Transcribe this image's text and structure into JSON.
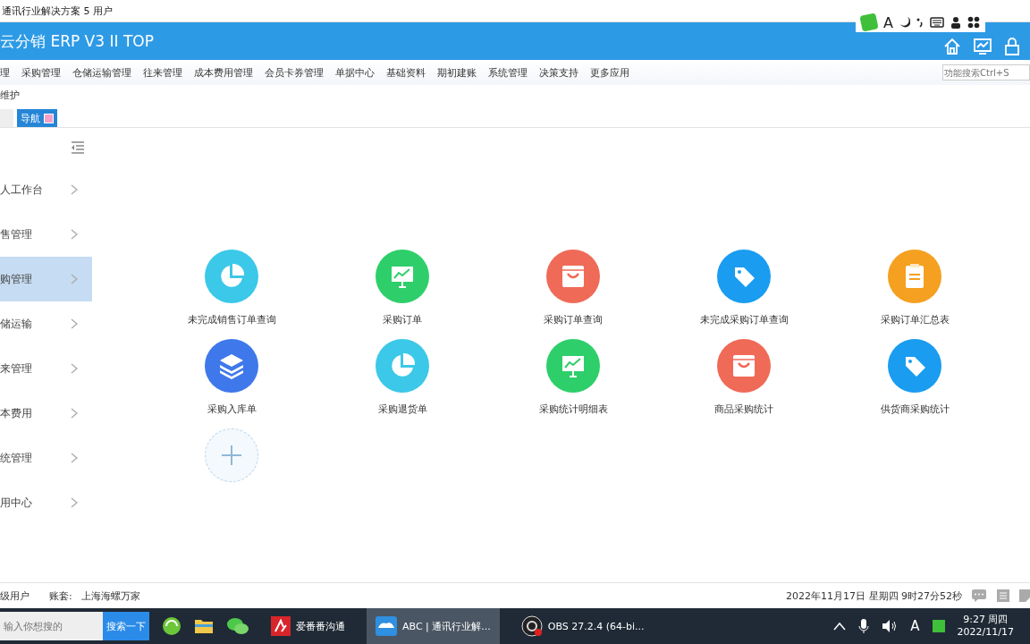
{
  "window": {
    "title": "通讯行业解决方案 5 用户"
  },
  "header": {
    "title": "云分销 ERP V3 II TOP"
  },
  "menu": [
    "理",
    "采购管理",
    "仓储运输管理",
    "往来管理",
    "成本费用管理",
    "会员卡券管理",
    "单据中心",
    "基础资料",
    "期初建账",
    "系统管理",
    "决策支持",
    "更多应用"
  ],
  "function_search": {
    "placeholder": "功能搜索Ctrl+S"
  },
  "breadcrumb": "维护",
  "tabs": [
    {
      "label": "导航",
      "selected": true
    }
  ],
  "sidebar": {
    "items": [
      {
        "label": "人工作台",
        "selected": false
      },
      {
        "label": "售管理",
        "selected": false
      },
      {
        "label": "购管理",
        "selected": true
      },
      {
        "label": "储运输",
        "selected": false
      },
      {
        "label": "来管理",
        "selected": false
      },
      {
        "label": "本费用",
        "selected": false
      },
      {
        "label": "统管理",
        "selected": false
      },
      {
        "label": "用中心",
        "selected": false
      }
    ]
  },
  "tiles": [
    {
      "label": "未完成销售订单查询",
      "kind": "pie",
      "color": "#3cc8e8"
    },
    {
      "label": "采购订单",
      "kind": "chart",
      "color": "#2ecf6a"
    },
    {
      "label": "采购订单查询",
      "kind": "bag",
      "color": "#f06a58"
    },
    {
      "label": "未完成采购订单查询",
      "kind": "tag",
      "color": "#1a9cf0"
    },
    {
      "label": "采购订单汇总表",
      "kind": "clipboard",
      "color": "#f5a020"
    },
    {
      "label": "采购入库单",
      "kind": "layers",
      "color": "#3f78ea"
    },
    {
      "label": "采购退货单",
      "kind": "pie",
      "color": "#3cc8e8"
    },
    {
      "label": "采购统计明细表",
      "kind": "chart",
      "color": "#2ecf6a"
    },
    {
      "label": "商品采购统计",
      "kind": "bag",
      "color": "#f06a58"
    },
    {
      "label": "供货商采购统计",
      "kind": "tag",
      "color": "#1a9cf0"
    }
  ],
  "status_bar": {
    "user": "级用户",
    "account_label": "账套:",
    "account": "上海海螺万家",
    "datetime": "2022年11月17日 星期四 9时27分52秒"
  },
  "ime_toolbar": {
    "letter": "A"
  },
  "taskbar": {
    "search": {
      "placeholder": "输入你想搜的"
    },
    "search_button": "搜索一下",
    "apps": [
      {
        "label": "爱番番沟通",
        "selected": false,
        "kind": "chat"
      },
      {
        "label": "ABC | 通讯行业解...",
        "selected": true,
        "kind": "cloud"
      },
      {
        "label": "OBS 27.2.4 (64-bi...",
        "selected": false,
        "kind": "obs"
      }
    ],
    "input_letter": "A",
    "time": "9:27 周四",
    "date": "2022/11/17"
  }
}
